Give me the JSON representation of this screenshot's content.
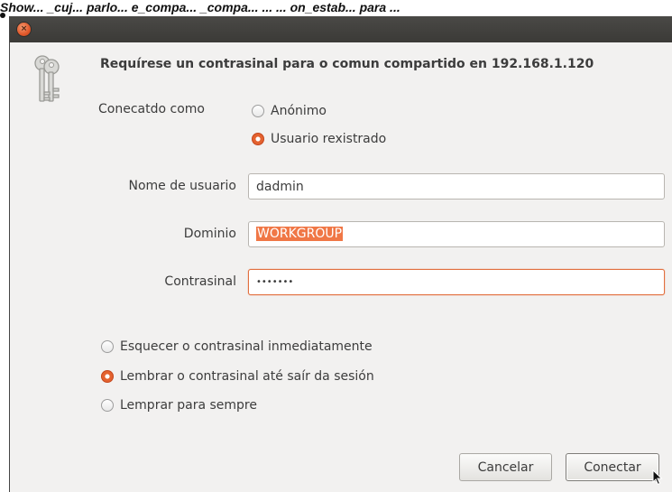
{
  "caption": "Show... _cuj... parlo... e_compa... _compa... ... ... on_estab... para ...",
  "dialog": {
    "heading": "Requírese un contrasinal para o comun compartido en 192.168.1.120",
    "connect_as_label": "Conecatdo como",
    "connect_as_options": [
      {
        "label": "Anónimo",
        "checked": false
      },
      {
        "label": "Usuario rexistrado",
        "checked": true
      }
    ],
    "username_label": "Nome de usuario",
    "username_value": "dadmin",
    "domain_label": "Dominio",
    "domain_value": "WORKGROUP",
    "password_label": "Contrasinal",
    "password_value": "•••••••",
    "remember_options": [
      {
        "label": "Esquecer o contrasinal inmediatamente",
        "checked": false
      },
      {
        "label": "Lembrar o contrasinal até saír da sesión",
        "checked": true
      },
      {
        "label": "Lemprar para sempre",
        "checked": false
      }
    ],
    "cancel_label": "Cancelar",
    "connect_label": "Conectar"
  },
  "colors": {
    "accent": "#e4622f",
    "titlebar": "#3b3a37",
    "dialog_bg": "#f2f1f0"
  }
}
